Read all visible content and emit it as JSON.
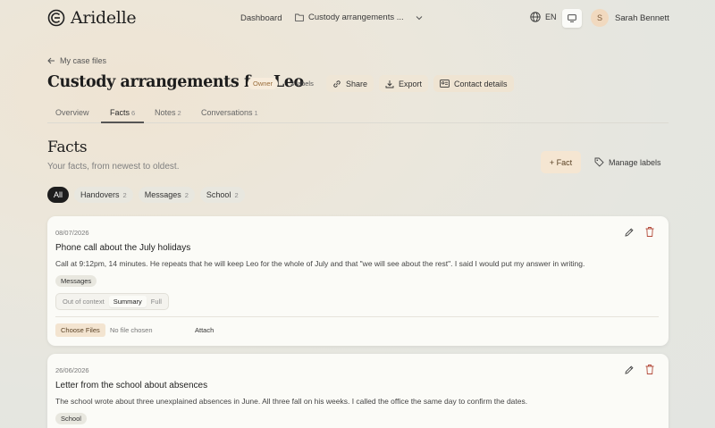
{
  "app": {
    "name": "Aridelle"
  },
  "nav": {
    "dashboard": "Dashboard",
    "case": "Custody arrangements ...",
    "lang": "EN",
    "user": {
      "name": "Sarah Bennett",
      "initial": "S"
    }
  },
  "header": {
    "back": "My case files",
    "title": "Custody arrangements for Leo",
    "owner": "Owner",
    "labels": "3 labels",
    "share": "Share",
    "export": "Export",
    "contact": "Contact details"
  },
  "tabs": [
    {
      "label": "Overview",
      "count": ""
    },
    {
      "label": "Facts",
      "count": "6"
    },
    {
      "label": "Notes",
      "count": "2"
    },
    {
      "label": "Conversations",
      "count": "1"
    }
  ],
  "facts": {
    "title": "Facts",
    "subtitle": "Your facts, from newest to oldest.",
    "add": "+ Fact",
    "manage": "Manage labels"
  },
  "chips": [
    {
      "label": "All",
      "count": ""
    },
    {
      "label": "Handovers",
      "count": "2"
    },
    {
      "label": "Messages",
      "count": "2"
    },
    {
      "label": "School",
      "count": "2"
    }
  ],
  "cards": [
    {
      "date": "08/07/2026",
      "title": "Phone call about the July holidays",
      "body": "Call at 9:12pm, 14 minutes. He repeats that he will keep Leo for the whole of July and that \"we will see about the rest\". I said I would put my answer in writing.",
      "label": "Messages",
      "views": [
        "Out of context",
        "Summary",
        "Full"
      ],
      "choose": "Choose Files",
      "nofile": "No file chosen",
      "attach": "Attach"
    },
    {
      "date": "26/06/2026",
      "title": "Letter from the school about absences",
      "body": "The school wrote about three unexplained absences in June. All three fall on his weeks. I called the office the same day to confirm the dates.",
      "label": "School"
    }
  ],
  "colors": {
    "accent": "#f5e6d2",
    "danger": "#b34a3a",
    "dark_chip": "#1d1d1d"
  }
}
